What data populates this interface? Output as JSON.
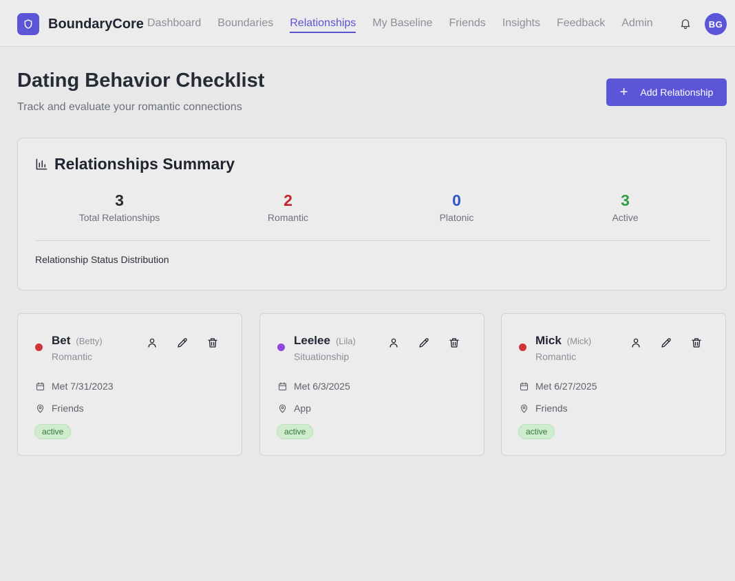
{
  "nav": {
    "brand": "BoundaryCore",
    "links": [
      {
        "label": "Dashboard",
        "active": false
      },
      {
        "label": "Boundaries",
        "active": false
      },
      {
        "label": "Relationships",
        "active": true
      },
      {
        "label": "My Baseline",
        "active": false
      },
      {
        "label": "Friends",
        "active": false
      },
      {
        "label": "Insights",
        "active": false
      },
      {
        "label": "Feedback",
        "active": false
      },
      {
        "label": "Admin",
        "active": false
      }
    ],
    "avatar": "BG"
  },
  "header": {
    "title": "Dating Behavior Checklist",
    "subtitle": "Track and evaluate your romantic connections",
    "add_button": "Add Relationship"
  },
  "summary": {
    "title": "Relationships Summary",
    "stats": [
      {
        "value": "3",
        "label": "Total Relationships",
        "color": "#262b36"
      },
      {
        "value": "2",
        "label": "Romantic",
        "color": "#c0262d"
      },
      {
        "value": "0",
        "label": "Platonic",
        "color": "#2f55c9"
      },
      {
        "value": "3",
        "label": "Active",
        "color": "#2f9e44"
      }
    ],
    "distribution_label": "Relationship Status Distribution"
  },
  "relationships": [
    {
      "name": "Bet",
      "nickname": "(Betty)",
      "type": "Romantic",
      "dot_color": "#d13438",
      "met": "Met 7/31/2023",
      "source": "Friends",
      "status": "active"
    },
    {
      "name": "Leelee",
      "nickname": "(Lila)",
      "type": "Situationship",
      "dot_color": "#9046e0",
      "met": "Met 6/3/2025",
      "source": "App",
      "status": "active"
    },
    {
      "name": "Mick",
      "nickname": "(Mick)",
      "type": "Romantic",
      "dot_color": "#d13438",
      "met": "Met 6/27/2025",
      "source": "Friends",
      "status": "active"
    }
  ],
  "colors": {
    "accent": "#5b55d8",
    "active_badge": "#cfeccf"
  }
}
